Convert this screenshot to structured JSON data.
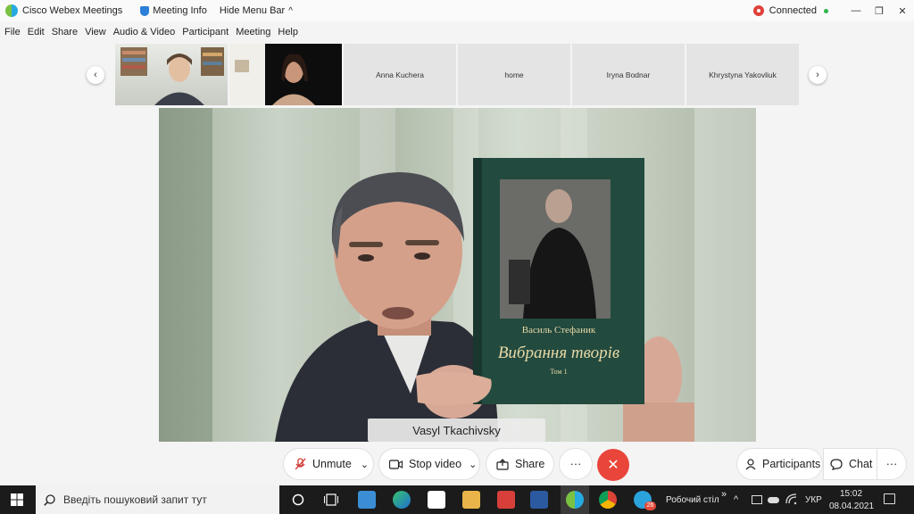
{
  "titlebar": {
    "app_name": "Cisco Webex Meetings",
    "meeting_info": "Meeting Info",
    "hide_menu": "Hide Menu Bar",
    "hide_menu_chevron": "^",
    "status": "Connected",
    "minimize": "—",
    "restore": "❐",
    "close": "✕"
  },
  "menubar": [
    "File",
    "Edit",
    "Share",
    "View",
    "Audio & Video",
    "Participant",
    "Meeting",
    "Help"
  ],
  "strip": {
    "prev_icon": "‹",
    "next_icon": "›",
    "participants": [
      "Anna Kuchera",
      "home",
      "Iryna Bodnar",
      "Khrystyna Yakovliuk"
    ]
  },
  "main_video": {
    "speaker_name": "Vasyl Tkachivsky",
    "book_author": "Василь Стефаник",
    "book_title": "Вибрання творів",
    "book_volume": "Том 1"
  },
  "controls": {
    "unmute": "Unmute",
    "stop_video": "Stop video",
    "share": "Share",
    "more": "···",
    "end": "✕",
    "participants": "Participants",
    "chat": "Chat",
    "chevron": "⌄"
  },
  "taskbar": {
    "search_placeholder": "Введіть пошуковий запит тут",
    "desktop": "Робочий стіл",
    "lang": "УКР",
    "time": "15:02",
    "date": "08.04.2021",
    "telegram_badge": "26"
  },
  "colors": {
    "end_call": "#e9453a",
    "connected": "#2fb44a",
    "record": "#e0403a"
  }
}
